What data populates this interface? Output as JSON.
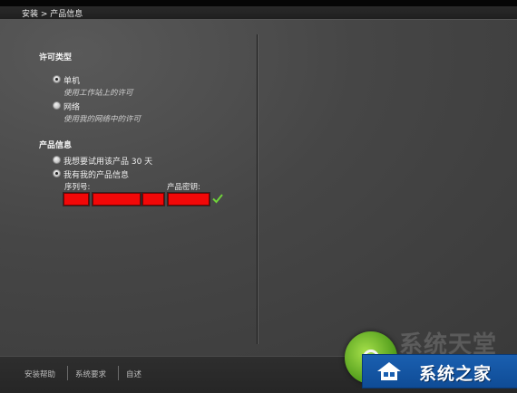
{
  "breadcrumb": "安装 > 产品信息",
  "license_section": {
    "title": "许可类型",
    "options": [
      {
        "label": "单机",
        "description": "使用工作站上的许可",
        "selected": true
      },
      {
        "label": "网络",
        "description": "使用我的网络中的许可",
        "selected": false
      }
    ]
  },
  "product_section": {
    "title": "产品信息",
    "options": [
      {
        "label": "我想要试用该产品 30 天",
        "selected": false
      },
      {
        "label": "我有我的产品信息",
        "selected": true
      }
    ],
    "serial_label": "序列号:",
    "key_label": "产品密钥:",
    "key_valid": true,
    "redaction_color": "#f20808"
  },
  "footer": {
    "links": [
      "安装帮助",
      "系统要求",
      "自述"
    ]
  },
  "watermark": {
    "faint_text": "系统天堂",
    "banner_text": "系统之家",
    "banner_color": "#1a5fb0"
  }
}
